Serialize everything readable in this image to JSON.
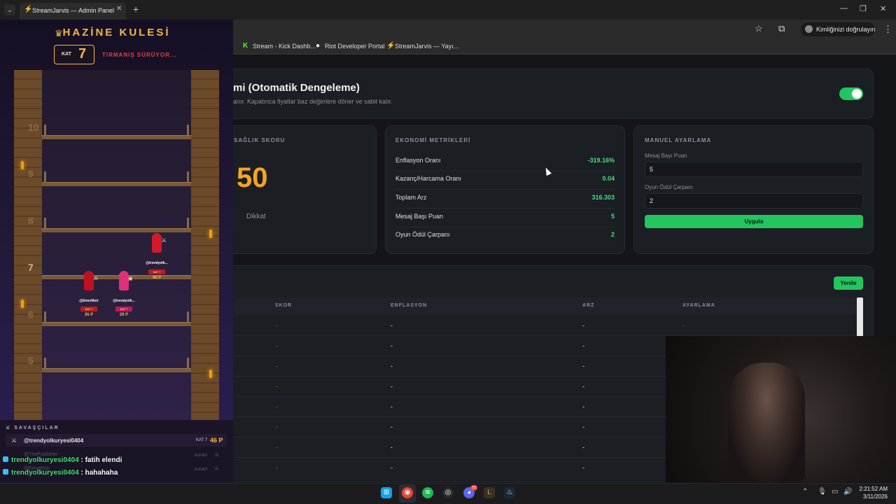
{
  "browser": {
    "tab_title": "StreamJarvis — Admin Panel",
    "verify_label": "Kimliğinizi doğrulayın",
    "bookmarks": [
      "Stream - Kick Dashb...",
      "Riot Developer Portal",
      "StreamJarvis — Yayı..."
    ]
  },
  "economy": {
    "title": "mi (Otomatik Dengeleme)",
    "description": "anır. Kapatınca fiyatlar baz değerlere döner ve sabit kalır.",
    "auto_balance_on": true,
    "accent_color": "#22c55e"
  },
  "health": {
    "label": "SAĞLIK SKORU",
    "score": "50",
    "status": "Dikkat",
    "score_color": "#f5a524"
  },
  "metrics": {
    "label": "EKONOMİ METRİKLERİ",
    "rows": [
      {
        "label": "Enflasyon Oranı",
        "value": "-319.16%"
      },
      {
        "label": "Kazanç/Harcama Oranı",
        "value": "0.04"
      },
      {
        "label": "Toplam Arz",
        "value": "316.303"
      },
      {
        "label": "Mesaj Başı Puan",
        "value": "5"
      },
      {
        "label": "Oyun Ödül Çarpanı",
        "value": "2"
      }
    ]
  },
  "manual": {
    "label": "MANUEL AYARLAMA",
    "field1_label": "Mesaj Başı Puan",
    "field1_value": "5",
    "field2_label": "Oyun Ödül Çarpanı",
    "field2_value": "2",
    "apply_label": "Uygula"
  },
  "history": {
    "refresh_label": "Yenile",
    "columns": [
      "SKOR",
      "ENFLASYON",
      "ARZ",
      "AYARLAMA"
    ],
    "rows": [
      [
        "-",
        "-",
        "-",
        "-"
      ],
      [
        "-",
        "-",
        "-",
        ""
      ],
      [
        "-",
        "-",
        "-",
        ""
      ],
      [
        "-",
        "-",
        "-",
        ""
      ],
      [
        "-",
        "-",
        "-",
        ""
      ],
      [
        "-",
        "-",
        "-",
        ""
      ],
      [
        "-",
        "-",
        "-",
        ""
      ],
      [
        "-",
        "-",
        "-",
        ""
      ]
    ]
  },
  "game": {
    "title": "HAZİNE KULESİ",
    "floor_label": "KAT",
    "floor_value": "7",
    "status": "TIRMANIŞ SÜRÜYOR...",
    "floor_numbers": [
      "10",
      "9",
      "8",
      "7",
      "6",
      "5"
    ],
    "players": [
      {
        "name": "@trendyolk...",
        "kat": "KAT 7",
        "points": "46 P"
      },
      {
        "name": "@EmreNoir",
        "kat": "KAT 7",
        "points": "26 P"
      },
      {
        "name": "@trendyolk...",
        "kat": "KAT 7",
        "points": "29 P"
      }
    ],
    "fighters_title": "SAVAŞÇILAR",
    "fighter": {
      "name": "@trendyolkuryesi0404",
      "kat": "KAT 7",
      "points": "46 P"
    },
    "faded_1": "@ThePublisher",
    "faded_2": "@EmreNoir",
    "eliminated": "ELENDİ"
  },
  "chat": [
    {
      "user": "trendyolkuryesi0404",
      "message": " : fatih elendi"
    },
    {
      "user": "trendyolkuryesi0404",
      "message": " : hahahaha"
    }
  ],
  "taskbar": {
    "time": "2:21:52 AM",
    "date": "3/11/2026",
    "discord_badge": "19"
  }
}
